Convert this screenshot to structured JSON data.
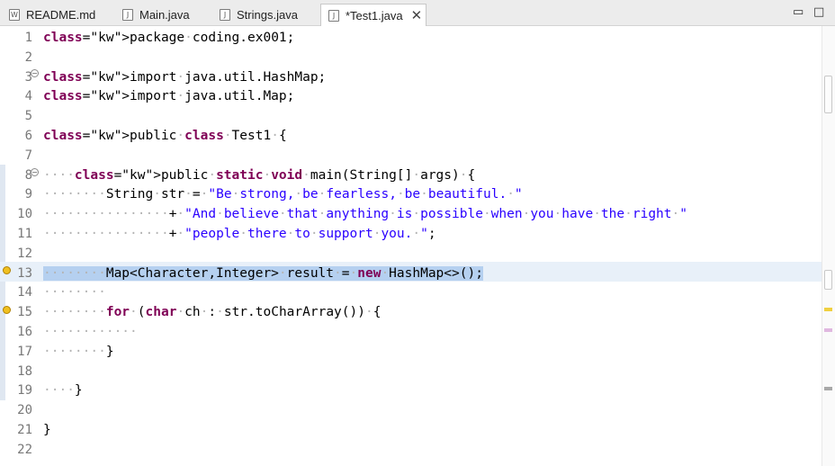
{
  "tabs": [
    {
      "label": "README.md",
      "icon": "markdown-file-icon",
      "active": false
    },
    {
      "label": "Main.java",
      "icon": "java-file-icon",
      "active": false
    },
    {
      "label": "Strings.java",
      "icon": "java-file-icon",
      "active": false
    },
    {
      "label": "*Test1.java",
      "icon": "java-file-icon",
      "active": true
    }
  ],
  "window_controls": {
    "minimize": "▭",
    "maximize": "□"
  },
  "editor": {
    "lines": [
      {
        "num": "1",
        "code": "package coding.ex001;"
      },
      {
        "num": "2",
        "code": ""
      },
      {
        "num": "3",
        "code": "import java.util.HashMap;"
      },
      {
        "num": "4",
        "code": "import java.util.Map;"
      },
      {
        "num": "5",
        "code": ""
      },
      {
        "num": "6",
        "code": "public class Test1 {"
      },
      {
        "num": "7",
        "code": ""
      },
      {
        "num": "8",
        "code": "    public static void main(String[] args) {"
      },
      {
        "num": "9",
        "code": "        String str = \"Be strong, be fearless, be beautiful. \""
      },
      {
        "num": "10",
        "code": "                + \"And believe that anything is possible when you have the right \""
      },
      {
        "num": "11",
        "code": "                + \"people there to support you. \";"
      },
      {
        "num": "12",
        "code": ""
      },
      {
        "num": "13",
        "code": "        Map<Character,Integer> result = new HashMap<>();"
      },
      {
        "num": "14",
        "code": "        "
      },
      {
        "num": "15",
        "code": "        for (char ch : str.toCharArray()) {"
      },
      {
        "num": "16",
        "code": "            "
      },
      {
        "num": "17",
        "code": "        }"
      },
      {
        "num": "18",
        "code": ""
      },
      {
        "num": "19",
        "code": "    }"
      },
      {
        "num": "20",
        "code": ""
      },
      {
        "num": "21",
        "code": "}"
      },
      {
        "num": "22",
        "code": ""
      }
    ],
    "current_line": "13",
    "warnings_on_lines": [
      "13",
      "15"
    ],
    "colors": {
      "keyword": "#7f0055",
      "string": "#2a00ff",
      "current_line": "#e8f0f9",
      "selection": "#b5d0f0",
      "warning": "#f0c020"
    }
  }
}
